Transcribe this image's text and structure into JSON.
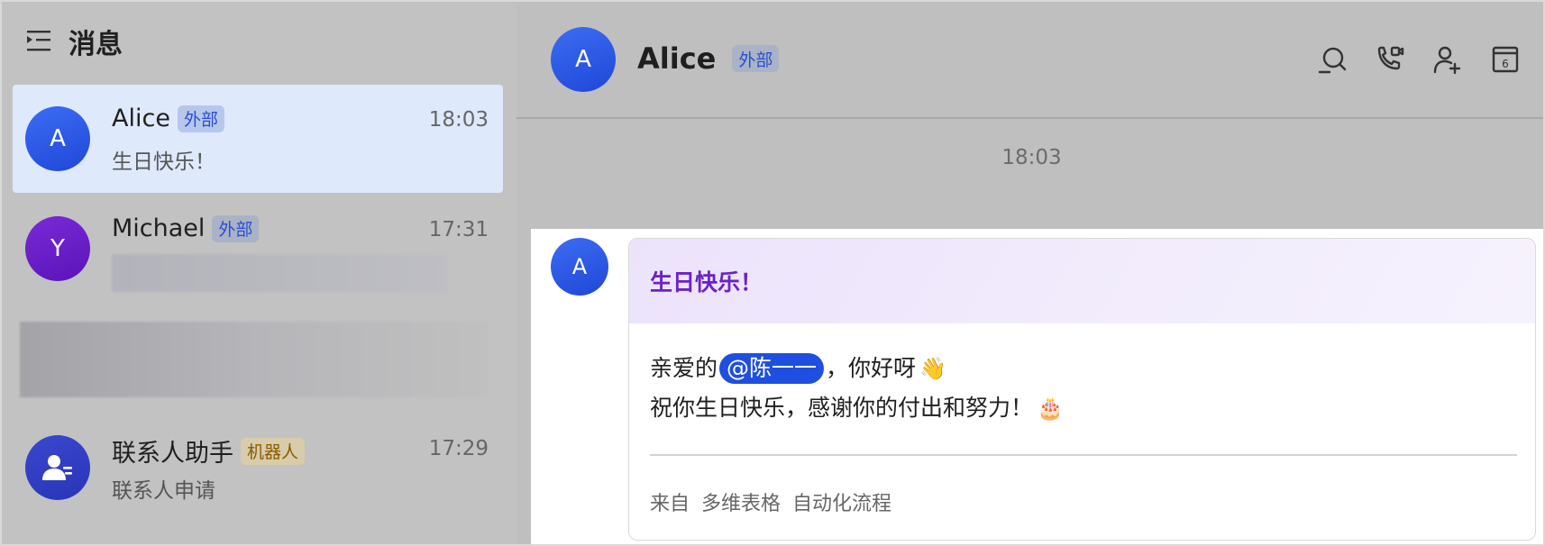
{
  "sidebar": {
    "title": "消息",
    "menu_icon": "indent-list-icon",
    "conversations": [
      {
        "name": "Alice",
        "avatar_letter": "A",
        "badge": "外部",
        "time": "18:03",
        "preview": "生日快乐！"
      },
      {
        "name": "Michael",
        "avatar_letter": "Y",
        "badge": "外部",
        "time": "17:31",
        "preview": ""
      },
      {
        "name": "联系人助手",
        "avatar_icon": "contact-person-icon",
        "badge": "机器人",
        "time": "17:29",
        "preview": "联系人申请"
      }
    ]
  },
  "chat": {
    "title": "Alice",
    "avatar_letter": "A",
    "badge": "外部",
    "header_icons": [
      "search-chat-icon",
      "video-call-icon",
      "add-member-icon",
      "calendar-icon"
    ],
    "calendar_day": "6",
    "time_separator": "18:03",
    "message": {
      "avatar_letter": "A",
      "card_title": "生日快乐！",
      "line1_prefix": "亲爱的",
      "mention": "@陈一一",
      "line1_suffix": "，你好呀",
      "line1_emoji": "👋",
      "line2_text": "祝你生日快乐，感谢你的付出和努力！",
      "line2_emoji": "🎂",
      "footer": [
        "来自",
        "多维表格",
        "自动化流程"
      ]
    }
  },
  "colors": {
    "accent": "#1f4fe0",
    "card_title": "#6b21c8",
    "active_item": "#dfe9fc"
  }
}
